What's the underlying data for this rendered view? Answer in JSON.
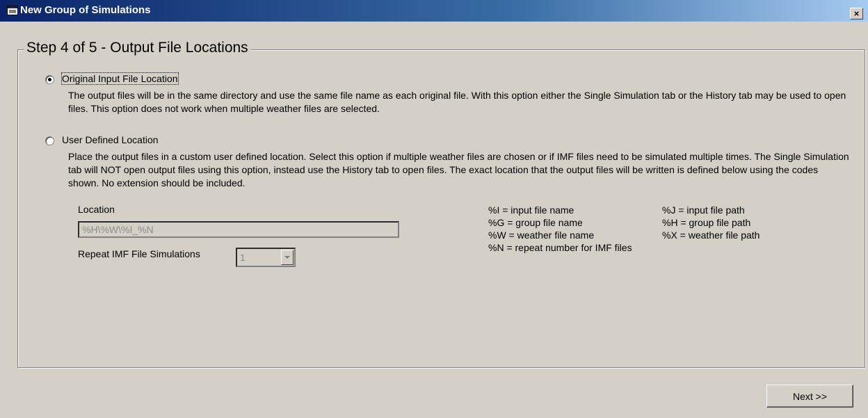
{
  "window": {
    "title": "New Group of Simulations",
    "close_glyph": "×",
    "icon": "app-window-icon"
  },
  "step_title": "Step 4 of 5 - Output File Locations",
  "options": [
    {
      "label": "Original Input File Location",
      "selected": true,
      "description": "The output files will be in the same directory and use the same file name as each original file. With this option either the Single Simulation tab or the History tab may be used to open files. This option does not work when multiple weather files are selected."
    },
    {
      "label": "User Defined Location",
      "selected": false,
      "description": "Place the output files in a custom user defined location. Select this option if multiple weather files are chosen or if IMF files need to be simulated multiple times.  The Single Simulation tab will NOT open output files using this option, instead use the History tab to open files. The exact location that the output files will be written is defined below using the codes shown. No extension should be included."
    }
  ],
  "location": {
    "label": "Location",
    "value": "%H\\%W\\%I_%N"
  },
  "repeat": {
    "label": "Repeat IMF File Simulations",
    "value": "1"
  },
  "codes": {
    "left": [
      "%I = input file name",
      "%G = group file name",
      "%W =  weather file name",
      "%N = repeat number for IMF files"
    ],
    "right": [
      "%J = input file path",
      "%H = group file path",
      "%X = weather file path"
    ]
  },
  "next_button": "Next >>"
}
